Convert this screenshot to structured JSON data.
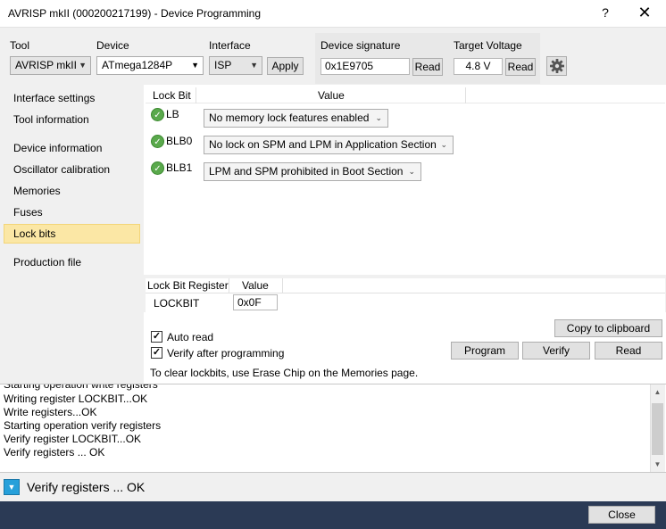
{
  "window": {
    "title": "AVRISP mkII (000200217199) - Device Programming",
    "help_label": "?",
    "close_label": "✕"
  },
  "toolbar": {
    "tool_label": "Tool",
    "tool_value": "AVRISP mkII",
    "device_label": "Device",
    "device_value": "ATmega1284P",
    "interface_label": "Interface",
    "interface_value": "ISP",
    "apply_label": "Apply",
    "signature_label": "Device signature",
    "signature_value": "0x1E9705",
    "signature_read_label": "Read",
    "voltage_label": "Target Voltage",
    "voltage_value": "4.8 V",
    "voltage_read_label": "Read",
    "settings_icon": "gear-icon"
  },
  "sidebar": {
    "items": [
      {
        "label": "Interface settings"
      },
      {
        "label": "Tool information"
      },
      {
        "label": "Device information"
      },
      {
        "label": "Oscillator calibration"
      },
      {
        "label": "Memories"
      },
      {
        "label": "Fuses"
      },
      {
        "label": "Lock bits"
      },
      {
        "label": "Production file"
      }
    ],
    "selected": "Lock bits"
  },
  "lockbits": {
    "col_lockbit": "Lock Bit",
    "col_value": "Value",
    "rows": [
      {
        "name": "LB",
        "value": "No memory lock features enabled"
      },
      {
        "name": "BLB0",
        "value": "No lock on SPM and LPM in Application Section"
      },
      {
        "name": "BLB1",
        "value": "LPM and SPM prohibited in Boot Section"
      }
    ],
    "status_icon": "check-circle-icon"
  },
  "register": {
    "col_register": "Lock Bit Register",
    "col_value": "Value",
    "name": "LOCKBIT",
    "value": "0x0F"
  },
  "actions": {
    "copy_label": "Copy to clipboard",
    "auto_read_label": "Auto read",
    "auto_read_checked": true,
    "verify_after_label": "Verify after programming",
    "verify_after_checked": true,
    "program_label": "Program",
    "verify_label": "Verify",
    "read_label": "Read",
    "hint": "To clear lockbits, use Erase Chip on the Memories page."
  },
  "log": {
    "lines": [
      "Starting operation write registers",
      "Writing register LOCKBIT...OK",
      "Write registers...OK",
      "Starting operation verify registers",
      "Verify register LOCKBIT...OK",
      "Verify registers ... OK"
    ]
  },
  "status": {
    "text": "Verify registers ... OK"
  },
  "footer": {
    "close_label": "Close"
  }
}
